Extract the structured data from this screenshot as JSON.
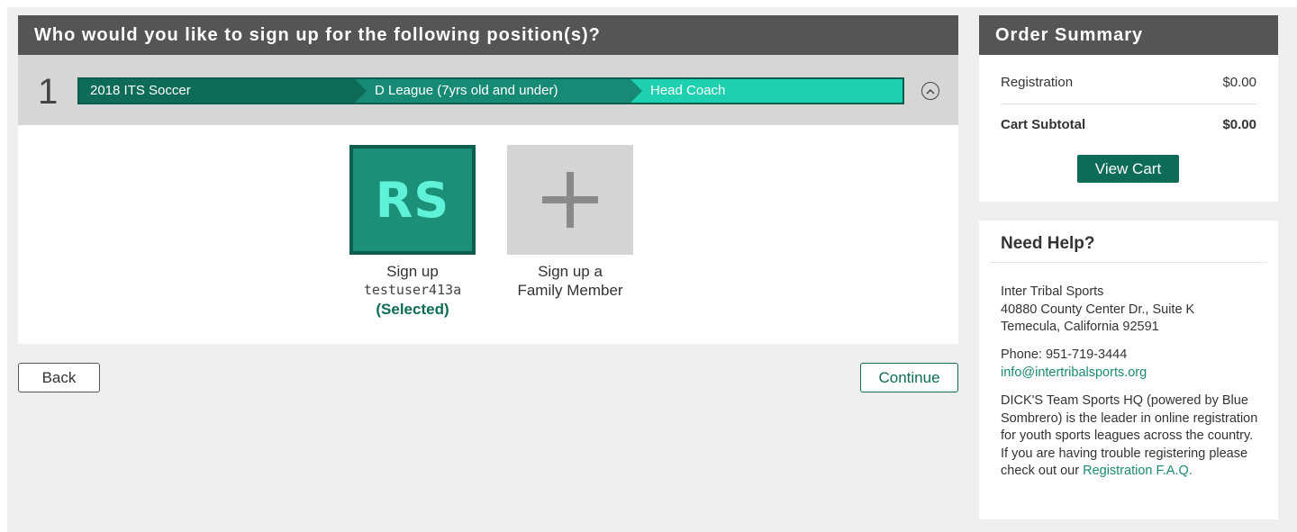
{
  "main": {
    "header": "Who would you like to sign up for the following position(s)?",
    "position_number": "1",
    "breadcrumb": [
      "2018 ITS Soccer",
      "D League (7yrs old and under)",
      "Head Coach"
    ],
    "collapse_icon": "chevron-up-circle-icon",
    "people": [
      {
        "initials": "RS",
        "label_line1": "Sign up",
        "label_line2": "testuser413a",
        "status": "(Selected)"
      },
      {
        "icon": "plus-icon",
        "label_line1": "Sign up a",
        "label_line2": "Family Member"
      }
    ],
    "back_label": "Back",
    "continue_label": "Continue"
  },
  "summary": {
    "title": "Order Summary",
    "registration_label": "Registration",
    "registration_value": "$0.00",
    "subtotal_label": "Cart Subtotal",
    "subtotal_value": "$0.00",
    "view_cart_label": "View Cart"
  },
  "help": {
    "title": "Need Help?",
    "org_name": "Inter Tribal Sports",
    "address_line1": "40880 County Center Dr., Suite K",
    "address_line2": "Temecula, California 92591",
    "phone": "Phone: 951-719-3444",
    "email": "info@intertribalsports.org",
    "about_text": "DICK'S Team Sports HQ (powered by Blue Sombrero) is the leader in online registration for youth sports leagues across the country. If you are having trouble registering please check out our",
    "faq_link": "Registration F.A.Q."
  },
  "colors": {
    "header_bg": "#555555",
    "brand_dark": "#0d6b58",
    "brand_mid": "#168a74",
    "brand_light": "#1ecfb0",
    "page_bg": "#efefef"
  }
}
